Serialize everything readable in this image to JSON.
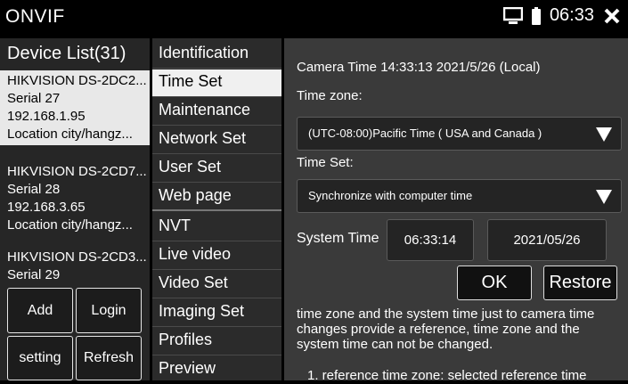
{
  "app": {
    "title": "ONVIF",
    "clock": "06:33"
  },
  "devices": {
    "header": "Device List(31)",
    "items": [
      {
        "name": "HIKVISION DS-2DC2...",
        "serial": "Serial 27",
        "ip": "192.168.1.95",
        "location": "Location city/hangz..."
      },
      {
        "name": "HIKVISION DS-2CD7...",
        "serial": "Serial 28",
        "ip": "192.168.3.65",
        "location": "Location city/hangz..."
      },
      {
        "name": "HIKVISION DS-2CD3...",
        "serial": "Serial 29"
      }
    ],
    "buttons": {
      "add": "Add",
      "login": "Login",
      "setting": "setting",
      "refresh": "Refresh"
    }
  },
  "menu": [
    "Identification",
    "Time Set",
    "Maintenance",
    "Network Set",
    "User Set",
    "Web page",
    "NVT",
    "Live video",
    "Video Set",
    "Imaging Set",
    "Profiles",
    "Preview"
  ],
  "timeset": {
    "camera_time": "Camera Time 14:33:13  2021/5/26 (Local)",
    "timezone_label": "Time zone:",
    "timezone_value": "(UTC-08:00)Pacific Time ( USA and Canada )",
    "timeset_label": "Time Set:",
    "timeset_value": "Synchronize with computer time",
    "system_time_label": "System Time",
    "system_time": "06:33:14",
    "system_date": "2021/05/26",
    "ok": "OK",
    "restore": "Restore",
    "help_text": "time zone and the system time just to camera time changes provide a reference, time zone and the system time can not be changed.",
    "help_item1": "1. reference time zone: selected reference time"
  }
}
